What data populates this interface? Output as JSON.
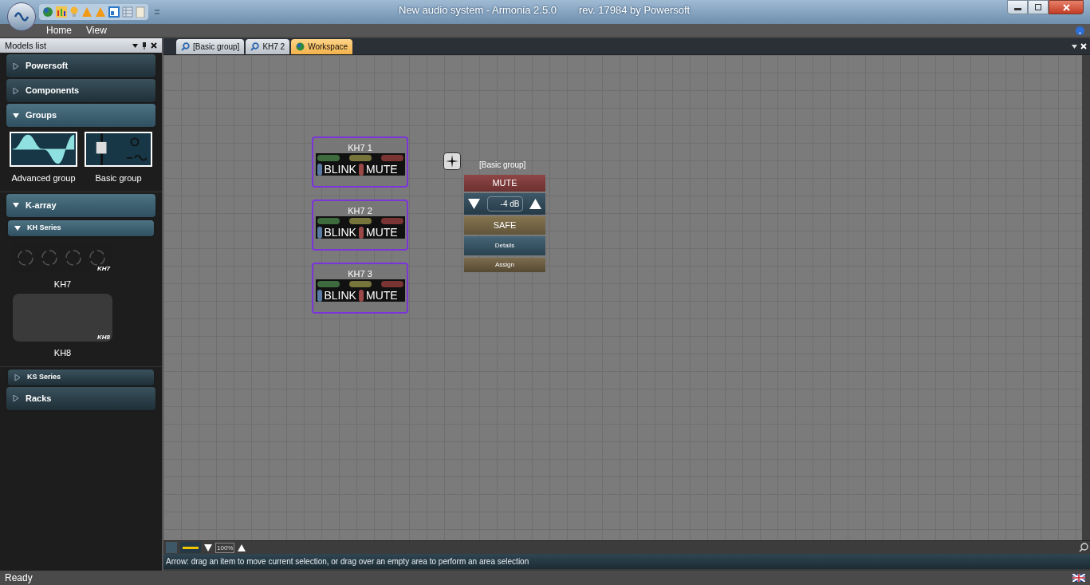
{
  "window": {
    "title": "New audio system - Armonia 2.5.0",
    "revision": "rev. 17984 by Powersoft"
  },
  "menu": [
    "Home",
    "View"
  ],
  "models_panel": {
    "title": "Models list",
    "sections": [
      {
        "label": "Powersoft",
        "expanded": false
      },
      {
        "label": "Components",
        "expanded": false
      },
      {
        "label": "Groups",
        "expanded": true,
        "items": [
          {
            "label": "Advanced group",
            "kind": "wave"
          },
          {
            "label": "Basic group",
            "kind": "fader"
          }
        ]
      },
      {
        "label": "K-array",
        "expanded": true,
        "children": [
          {
            "label": "KH Series",
            "expanded": true,
            "items": [
              {
                "label": "KH7",
                "kind": "knobs",
                "badge": "KH7"
              },
              {
                "label": "KH8",
                "kind": "blank",
                "badge": "KH8"
              }
            ]
          },
          {
            "label": "KS Series",
            "expanded": false
          }
        ]
      },
      {
        "label": "Racks",
        "expanded": false
      }
    ]
  },
  "doc_tabs": [
    {
      "label": "[Basic group]",
      "kind": "view",
      "selected": false
    },
    {
      "label": "KH7 2",
      "kind": "view",
      "selected": false
    },
    {
      "label": "Workspace",
      "kind": "workspace",
      "selected": true
    }
  ],
  "devices": [
    {
      "title": "KH7 1",
      "buttons": [
        "BLINK",
        "MUTE"
      ]
    },
    {
      "title": "KH7 2",
      "buttons": [
        "BLINK",
        "MUTE"
      ]
    },
    {
      "title": "KH7 3",
      "buttons": [
        "BLINK",
        "MUTE"
      ]
    }
  ],
  "group_panel": {
    "title": "[Basic group]",
    "mute": "MUTE",
    "gain": "-4 dB",
    "safe": "SAFE",
    "details": "Details",
    "assign": "Assign"
  },
  "zoom": "100%",
  "hint": "Arrow: drag an item to move current selection, or drag over an empty area to perform an area selection",
  "status_bar": "Ready"
}
